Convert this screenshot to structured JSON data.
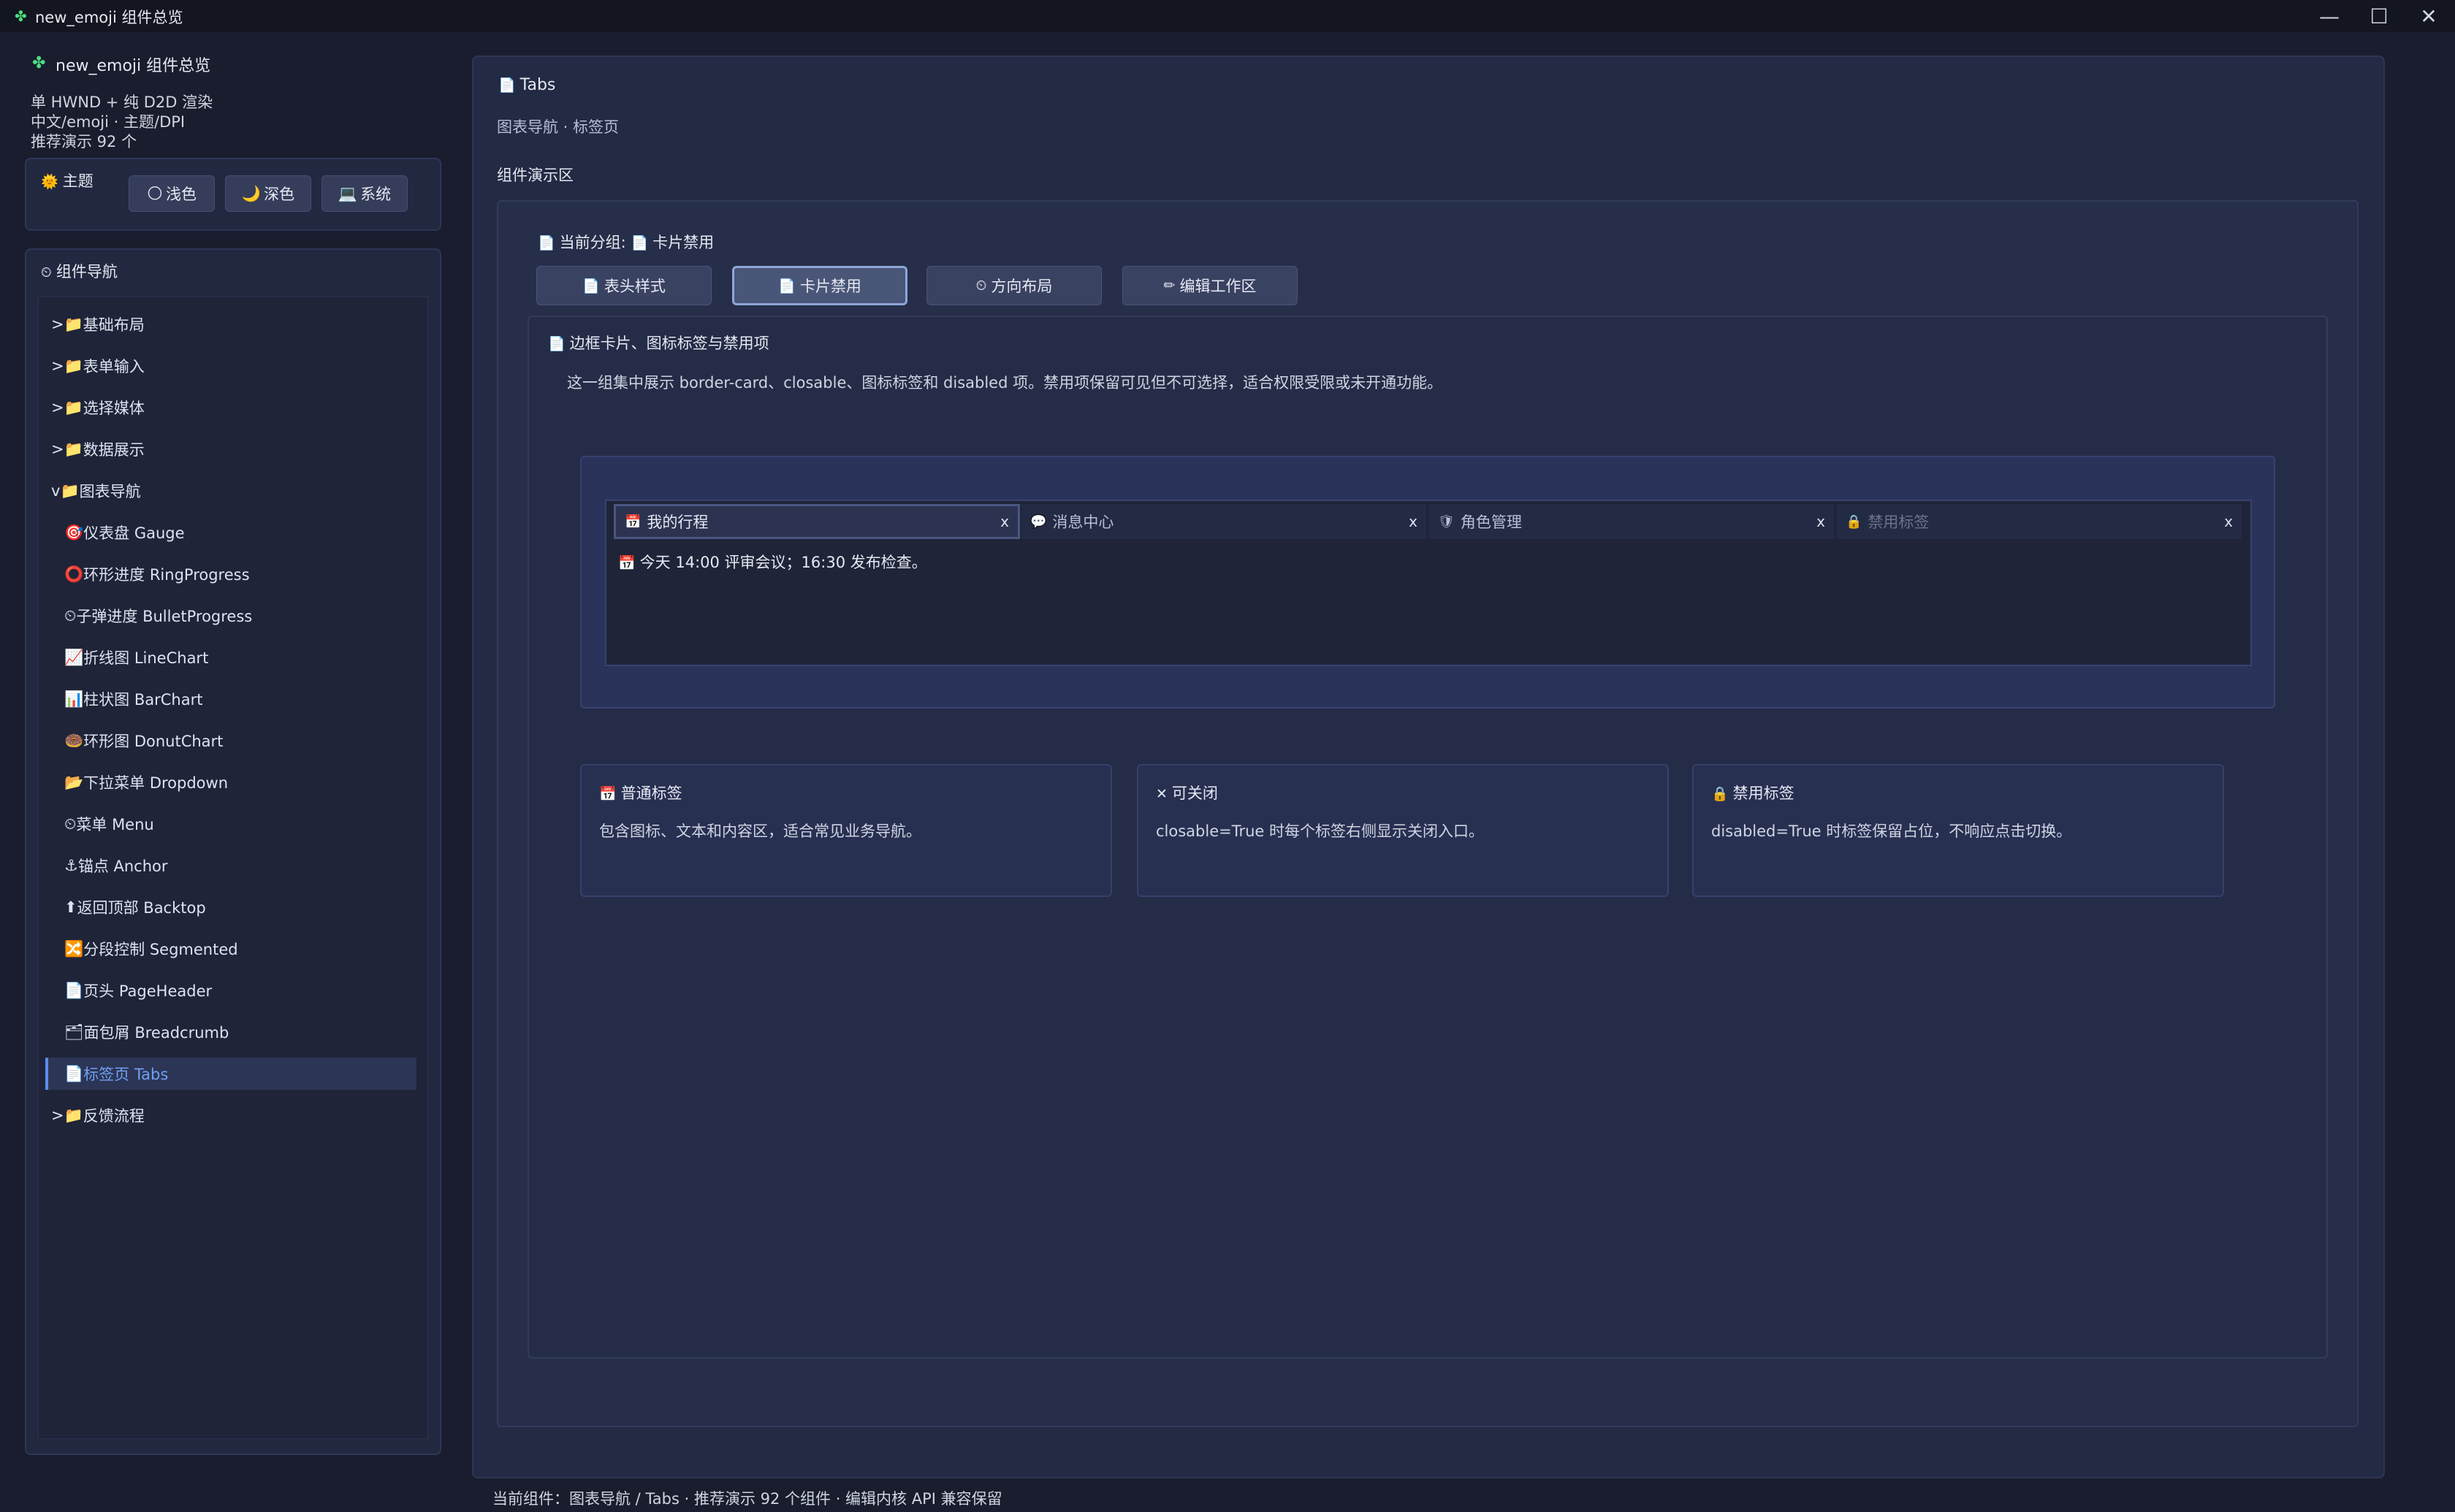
{
  "window": {
    "title": "new_emoji 组件总览",
    "minimize": "—",
    "maximize": "☐",
    "close": "✕"
  },
  "sidebar": {
    "app_title": "new_emoji 组件总览",
    "info": [
      "单 HWND + 纯 D2D 渲染",
      "中文/emoji · 主题/DPI",
      "推荐演示 92 个"
    ],
    "theme": {
      "label": "主题",
      "buttons": [
        {
          "icon": "🌕",
          "label": "浅色"
        },
        {
          "icon": "🌙",
          "label": "深色"
        },
        {
          "icon": "💻",
          "label": "系统"
        }
      ]
    },
    "nav_header": "组件导航",
    "nav_items": [
      {
        "prefix": ">",
        "icon": "📁",
        "label": "基础布局"
      },
      {
        "prefix": ">",
        "icon": "📁",
        "label": "表单输入"
      },
      {
        "prefix": ">",
        "icon": "📁",
        "label": "选择媒体"
      },
      {
        "prefix": ">",
        "icon": "📁",
        "label": "数据展示"
      },
      {
        "prefix": "v",
        "icon": "📁",
        "label": "图表导航"
      },
      {
        "icon": "🎯",
        "label": "仪表盘 Gauge"
      },
      {
        "icon": "⭕",
        "label": "环形进度 RingProgress"
      },
      {
        "icon": "⏲",
        "label": "子弹进度 BulletProgress"
      },
      {
        "icon": "📈",
        "label": "折线图 LineChart"
      },
      {
        "icon": "📊",
        "label": "柱状图 BarChart"
      },
      {
        "icon": "🍩",
        "label": "环形图 DonutChart"
      },
      {
        "icon": "📂",
        "label": "下拉菜单 Dropdown"
      },
      {
        "icon": "⏲",
        "label": "菜单 Menu"
      },
      {
        "icon": "⚓",
        "label": "锚点 Anchor"
      },
      {
        "icon": "⬆",
        "label": "返回顶部 Backtop"
      },
      {
        "icon": "🔀",
        "label": "分段控制 Segmented"
      },
      {
        "icon": "📄",
        "label": "页头 PageHeader"
      },
      {
        "icon": "🗂",
        "label": "面包屑 Breadcrumb"
      },
      {
        "icon": "📄",
        "label": "标签页 Tabs"
      },
      {
        "prefix": ">",
        "icon": "📁",
        "label": "反馈流程"
      }
    ]
  },
  "main": {
    "title": "Tabs",
    "subtitle": "图表导航 · 标签页",
    "demo_label": "组件演示区",
    "group_prefix": "当前分组:",
    "group_value": "卡片禁用",
    "segments": [
      {
        "icon": "📄",
        "label": "表头样式"
      },
      {
        "icon": "📄",
        "label": "卡片禁用"
      },
      {
        "icon": "⏲",
        "label": "方向布局"
      },
      {
        "icon": "✏",
        "label": "编辑工作区"
      }
    ],
    "section_title": "边框卡片、图标标签与禁用项",
    "section_desc": "这一组集中展示 border-card、closable、图标标签和 disabled 项。禁用项保留可见但不可选择，适合权限受限或未开通功能。",
    "tabs": [
      {
        "icon": "📅",
        "label": "我的行程",
        "close": "x"
      },
      {
        "icon": "💬",
        "label": "消息中心",
        "close": "x"
      },
      {
        "icon": "🛡",
        "label": "角色管理",
        "close": "x"
      },
      {
        "icon": "🔒",
        "label": "禁用标签",
        "close": "x"
      }
    ],
    "tab_content": "今天 14:00 评审会议；16:30 发布检查。",
    "cards": [
      {
        "icon": "📅",
        "title": "普通标签",
        "desc": "包含图标、文本和内容区，适合常见业务导航。"
      },
      {
        "icon": "✕",
        "title": "可关闭",
        "desc": "closable=True 时每个标签右侧显示关闭入口。"
      },
      {
        "icon": "🔒",
        "title": "禁用标签",
        "desc": "disabled=True 时标签保留占位，不响应点击切换。"
      }
    ]
  },
  "status": "当前组件：图表导航 / Tabs · 推荐演示 92 个组件 · 编辑内核 API 兼容保留"
}
